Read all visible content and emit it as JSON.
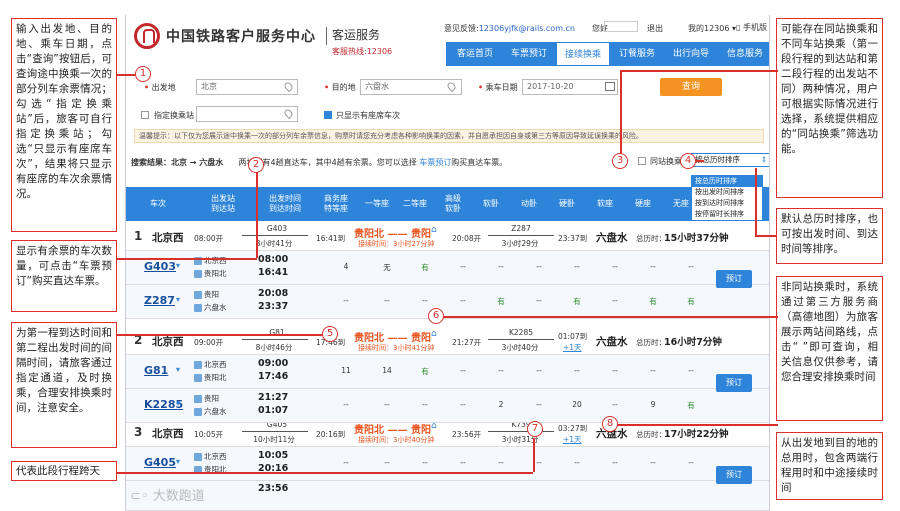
{
  "annotations": {
    "a1": "输入出发地、目的地、乘车日期，点击“查询”按钮后，可查询途中换乘一次的部分列车余票情况；勾选“指定换乘站”后，旅客可自行指定换乘站；勾选“只显示有座席车次”，结果将只显示有座席的车次余票情况。",
    "a2": "显示有余票的车次数量，可点击“车票预订”购买直达车票。",
    "a3": "为第一程到达时间和第二程出发时间的间隔时间，请旅客通过指定通道，及时换乘，合理安排换乘时间，注意安全。",
    "a4": "代表此段行程跨天",
    "a5": "可能存在同站换乘和不同车站换乘（第一段行程的到达站和第二段行程的出发站不同）两种情况，用户可根据实际情况进行选择，系统提供相应的“同站换乘”筛选功能。",
    "a6": "默认总历时排序，也可按出发时间、到达时间等排序。",
    "a7": "非同站换乘时，系统通过第三方服务商（高德地图）为旅客展示两站间路线，点击“ ”即可查询，相关信息仅供参考，请您合理安排换乘时间",
    "a8": "从出发地到目的地的总用时，包含两端行程用时和中途接续时间"
  },
  "markers": [
    "1",
    "2",
    "3",
    "4",
    "5",
    "6",
    "7",
    "8"
  ],
  "header": {
    "org": "中国铁路客户服务中心",
    "service": "客运服务",
    "hotline": "客服热线:12306",
    "feedback": "意见反馈:",
    "mail": "12306yjfk@rails.com.cn",
    "hello": "您好",
    "logout": "退出",
    "my": "我的12306",
    "phone": "手机版"
  },
  "nav": [
    "客运首页",
    "车票预订",
    "接续换乘",
    "订餐服务",
    "出行向导",
    "信息服务"
  ],
  "form": {
    "from_label": "出发地",
    "from": "北京",
    "to_label": "目的地",
    "to": "六盘水",
    "date_label": "乘车日期",
    "date": "2017-10-20",
    "query": "查询",
    "transfer_label": "指定换乘站",
    "seat_only": "只显示有座席车次"
  },
  "tip": "温馨提示：以下仅为您展示途中换乘一次的部分列车余票信息，购票时请您充分考虑各种影响换乘的因素，并自愿承担因自身或第三方等原因导致延误换乘的风险。",
  "result": {
    "text": "搜索结果：北京 → 六盘水",
    "count": "两地间有4趟直达车，其中4趟有余票。您可以选择",
    "link": "车票预订",
    "tail": "购买直达车票。",
    "same_station": "同站换乘",
    "sort": "按总历时排序"
  },
  "sort_options": [
    "按总历时排序",
    "按出发时间排序",
    "按到达时间排序",
    "按停留时长排序"
  ],
  "columns": [
    "车次",
    "出发站\n到达站",
    "出发时间\n到达时间",
    "商务座\n特等座",
    "一等座",
    "二等座",
    "高级\n软卧",
    "软卧",
    "动卧",
    "硬卧",
    "软座",
    "硬座",
    "无座"
  ],
  "trips": [
    {
      "no": "1",
      "from": "北京西",
      "dep": "08:00开",
      "t1": "G403",
      "d1": "8小时41分",
      "arr1": "16:41到",
      "mid": "贵阳北 —— 贵阳",
      "wait": "接续时间：3小时27分钟",
      "dep2": "20:08开",
      "t2": "Z287",
      "d2": "3小时29分",
      "arr2": "23:37到",
      "to": "六盘水",
      "total_l": "总历时：",
      "total": "15小时37分钟",
      "plus": ""
    },
    {
      "no": "2",
      "from": "北京西",
      "dep": "09:00开",
      "t1": "G81",
      "d1": "8小时46分",
      "arr1": "17:46到",
      "mid": "贵阳北 —— 贵阳",
      "wait": "接续时间：3小时41分钟",
      "dep2": "21:27开",
      "t2": "K2285",
      "d2": "3小时40分",
      "arr2": "01:07到",
      "to": "六盘水",
      "total_l": "总历时：",
      "total": "16小时7分钟",
      "plus": "+1天"
    },
    {
      "no": "3",
      "from": "北京西",
      "dep": "10:05开",
      "t1": "G405",
      "d1": "10小时11分",
      "arr1": "20:16到",
      "mid": "贵阳北 —— 贵阳",
      "wait": "接续时间：3小时40分钟",
      "dep2": "23:56开",
      "t2": "K739",
      "d2": "3小时31分",
      "arr2": "03:27到",
      "to": "六盘水",
      "total_l": "总历时：",
      "total": "17小时22分钟",
      "plus": "+1天"
    }
  ],
  "segments": [
    {
      "train": "G403",
      "s1": "北京西",
      "s2": "贵阳北",
      "t1": "08:00",
      "t2": "16:41",
      "seats": [
        "4",
        "无",
        "有",
        "--",
        "--",
        "--",
        "--",
        "--",
        "--",
        "--"
      ],
      "book": "预订"
    },
    {
      "train": "Z287",
      "s1": "贵阳",
      "s2": "六盘水",
      "t1": "20:08",
      "t2": "23:37",
      "seats": [
        "--",
        "--",
        "--",
        "--",
        "有",
        "--",
        "有",
        "--",
        "有",
        "有"
      ],
      "book": "预订"
    },
    {
      "train": "G81",
      "s1": "北京西",
      "s2": "贵阳北",
      "t1": "09:00",
      "t2": "17:46",
      "seats": [
        "11",
        "14",
        "有",
        "--",
        "--",
        "--",
        "--",
        "--",
        "--",
        "--"
      ],
      "book": "预订"
    },
    {
      "train": "K2285",
      "s1": "贵阳",
      "s2": "六盘水",
      "t1": "21:27",
      "t2": "01:07",
      "seats": [
        "--",
        "--",
        "--",
        "--",
        "2",
        "--",
        "20",
        "--",
        "9",
        "有"
      ],
      "book": "预订"
    },
    {
      "train": "G405",
      "s1": "北京西",
      "s2": "贵阳北",
      "t1": "10:05",
      "t2": "20:16",
      "seats": [
        "--",
        "--",
        "--",
        "--",
        "--",
        "--",
        "--",
        "--",
        "--",
        "--"
      ],
      "book": "预订"
    },
    {
      "train": "",
      "s1": "",
      "s2": "",
      "t1": "",
      "t2": "23:56",
      "seats": [
        "",
        "",
        "",
        "",
        "",
        "",
        "",
        "",
        "",
        ""
      ],
      "book": ""
    }
  ],
  "watermark": "大数跑道",
  "colors": {
    "accent": "#2d84d8",
    "annotation": "#d9302c",
    "orange": "#e8531d",
    "query": "#f39321"
  }
}
